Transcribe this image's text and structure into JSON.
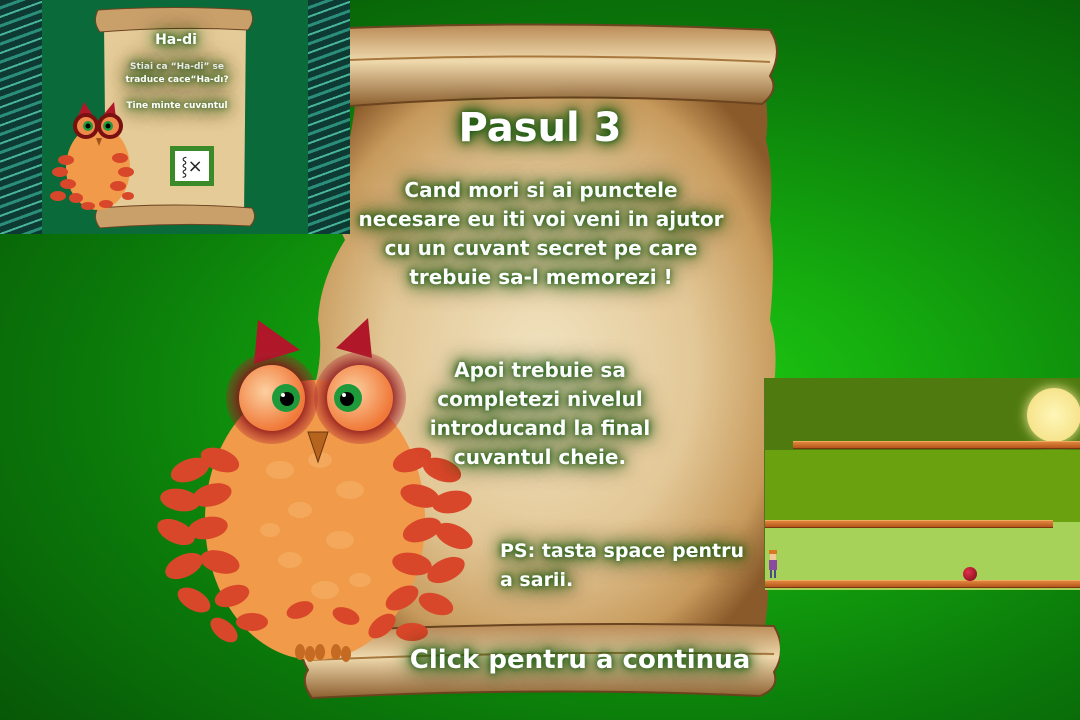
{
  "main": {
    "title": "Pasul 3",
    "paragraph1": "Cand mori si ai punctele necesare eu iti voi veni in ajutor cu un cuvant secret pe care trebuie sa-l memorezi !",
    "paragraph2": "Apoi trebuie sa completezi nivelul introducand la final cuvantul cheie.",
    "ps": "PS: tasta space pentru a sarii.",
    "continue_label": "Click pentru a continua"
  },
  "thumbnail": {
    "title": "Ha-di",
    "text1": "Stiai ca “Ha-di” se traduce сасе“Ha-dı?",
    "text2": "Tine minte cuvantul",
    "sign_icon": "broken-image-icon",
    "sign_glyph": "⸾×"
  },
  "colors": {
    "background": "#14a80e",
    "parchment": "#e7d1a0",
    "owl_body": "#f09a4a",
    "owl_leaves": "#d9472a",
    "owl_horns": "#b0182a",
    "sun": "#fbf0a0",
    "platform": "#c8642a"
  }
}
